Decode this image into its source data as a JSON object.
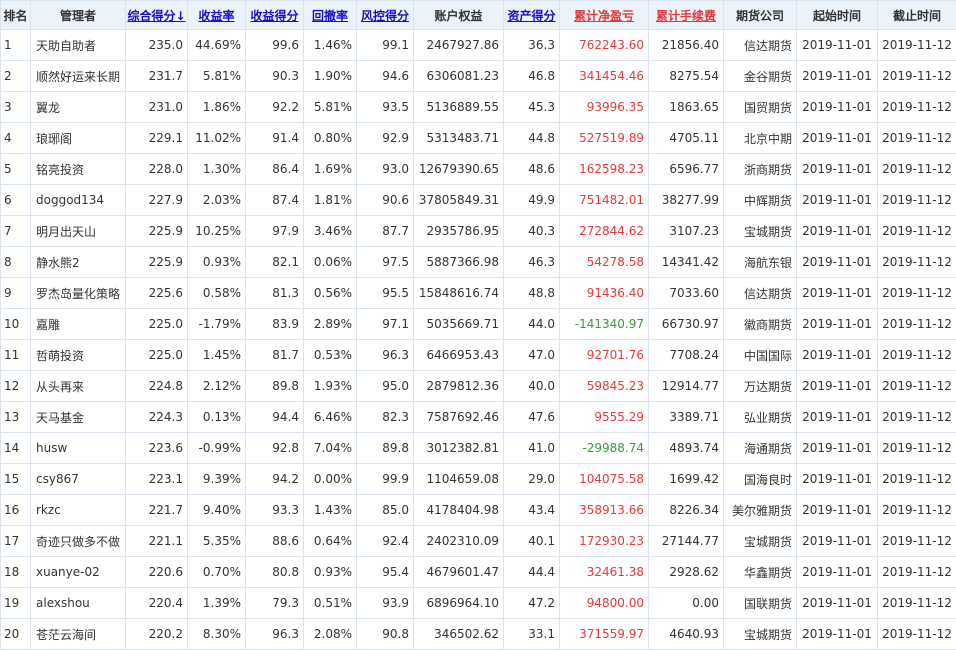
{
  "table": {
    "headers": [
      "排名",
      "管理者",
      "综合得分↓",
      "收益率",
      "收益得分",
      "回撤率",
      "风控得分",
      "账户权益",
      "资产得分",
      "累计净盈亏",
      "累计手续费",
      "期货公司",
      "起始时间",
      "截止时间"
    ],
    "sortable_columns": [
      2,
      3,
      4,
      5,
      6,
      8
    ],
    "red_link_columns": [
      9,
      10
    ],
    "pnl_colors": {
      "positive": "#e4393c",
      "negative": "#3c9a3c"
    },
    "rows": [
      [
        "1",
        "天助自助者",
        "235.0",
        "44.69%",
        "99.6",
        "1.46%",
        "99.1",
        "2467927.86",
        "36.3",
        "762243.60",
        "21856.40",
        "信达期货",
        "2019-11-01",
        "2019-11-12"
      ],
      [
        "2",
        "顺然好运来长期",
        "231.7",
        "5.81%",
        "90.3",
        "1.90%",
        "94.6",
        "6306081.23",
        "46.8",
        "341454.46",
        "8275.54",
        "金谷期货",
        "2019-11-01",
        "2019-11-12"
      ],
      [
        "3",
        "翼龙",
        "231.0",
        "1.86%",
        "92.2",
        "5.81%",
        "93.5",
        "5136889.55",
        "45.3",
        "93996.35",
        "1863.65",
        "国贸期货",
        "2019-11-01",
        "2019-11-12"
      ],
      [
        "4",
        "琅琊阁",
        "229.1",
        "11.02%",
        "91.4",
        "0.80%",
        "92.9",
        "5313483.71",
        "44.8",
        "527519.89",
        "4705.11",
        "北京中期",
        "2019-11-01",
        "2019-11-12"
      ],
      [
        "5",
        "铭亮投资",
        "228.0",
        "1.30%",
        "86.4",
        "1.69%",
        "93.0",
        "12679390.65",
        "48.6",
        "162598.23",
        "6596.77",
        "浙商期货",
        "2019-11-01",
        "2019-11-12"
      ],
      [
        "6",
        "doggod134",
        "227.9",
        "2.03%",
        "87.4",
        "1.81%",
        "90.6",
        "37805849.31",
        "49.9",
        "751482.01",
        "38277.99",
        "中辉期货",
        "2019-11-01",
        "2019-11-12"
      ],
      [
        "7",
        "明月出天山",
        "225.9",
        "10.25%",
        "97.9",
        "3.46%",
        "87.7",
        "2935786.95",
        "40.3",
        "272844.62",
        "3107.23",
        "宝城期货",
        "2019-11-01",
        "2019-11-12"
      ],
      [
        "8",
        "静水熊2",
        "225.9",
        "0.93%",
        "82.1",
        "0.06%",
        "97.5",
        "5887366.98",
        "46.3",
        "54278.58",
        "14341.42",
        "海航东银",
        "2019-11-01",
        "2019-11-12"
      ],
      [
        "9",
        "罗杰岛量化策略",
        "225.6",
        "0.58%",
        "81.3",
        "0.56%",
        "95.5",
        "15848616.74",
        "48.8",
        "91436.40",
        "7033.60",
        "信达期货",
        "2019-11-01",
        "2019-11-12"
      ],
      [
        "10",
        "嘉雕",
        "225.0",
        "-1.79%",
        "83.9",
        "2.89%",
        "97.1",
        "5035669.71",
        "44.0",
        "-141340.97",
        "66730.97",
        "徽商期货",
        "2019-11-01",
        "2019-11-12"
      ],
      [
        "11",
        "哲萌投资",
        "225.0",
        "1.45%",
        "81.7",
        "0.53%",
        "96.3",
        "6466953.43",
        "47.0",
        "92701.76",
        "7708.24",
        "中国国际",
        "2019-11-01",
        "2019-11-12"
      ],
      [
        "12",
        "从头再来",
        "224.8",
        "2.12%",
        "89.8",
        "1.93%",
        "95.0",
        "2879812.36",
        "40.0",
        "59845.23",
        "12914.77",
        "万达期货",
        "2019-11-01",
        "2019-11-12"
      ],
      [
        "13",
        "天马基金",
        "224.3",
        "0.13%",
        "94.4",
        "6.46%",
        "82.3",
        "7587692.46",
        "47.6",
        "9555.29",
        "3389.71",
        "弘业期货",
        "2019-11-01",
        "2019-11-12"
      ],
      [
        "14",
        "husw",
        "223.6",
        "-0.99%",
        "92.8",
        "7.04%",
        "89.8",
        "3012382.81",
        "41.0",
        "-29988.74",
        "4893.74",
        "海通期货",
        "2019-11-01",
        "2019-11-12"
      ],
      [
        "15",
        "csy867",
        "223.1",
        "9.39%",
        "94.2",
        "0.00%",
        "99.9",
        "1104659.08",
        "29.0",
        "104075.58",
        "1699.42",
        "国海良时",
        "2019-11-01",
        "2019-11-12"
      ],
      [
        "16",
        "rkzc",
        "221.7",
        "9.40%",
        "93.3",
        "1.43%",
        "85.0",
        "4178404.98",
        "43.4",
        "358913.66",
        "8226.34",
        "美尔雅期货",
        "2019-11-01",
        "2019-11-12"
      ],
      [
        "17",
        "奇迹只做多不做",
        "221.1",
        "5.35%",
        "88.6",
        "0.64%",
        "92.4",
        "2402310.09",
        "40.1",
        "172930.23",
        "27144.77",
        "宝城期货",
        "2019-11-01",
        "2019-11-12"
      ],
      [
        "18",
        "xuanye-02",
        "220.6",
        "0.70%",
        "80.8",
        "0.93%",
        "95.4",
        "4679601.47",
        "44.4",
        "32461.38",
        "2928.62",
        "华鑫期货",
        "2019-11-01",
        "2019-11-12"
      ],
      [
        "19",
        "alexshou",
        "220.4",
        "1.39%",
        "79.3",
        "0.51%",
        "93.9",
        "6896964.10",
        "47.2",
        "94800.00",
        "0.00",
        "国联期货",
        "2019-11-01",
        "2019-11-12"
      ],
      [
        "20",
        "苍茫云海间",
        "220.2",
        "8.30%",
        "96.3",
        "2.08%",
        "90.8",
        "346502.62",
        "33.1",
        "371559.97",
        "4640.93",
        "宝城期货",
        "2019-11-01",
        "2019-11-12"
      ]
    ]
  }
}
